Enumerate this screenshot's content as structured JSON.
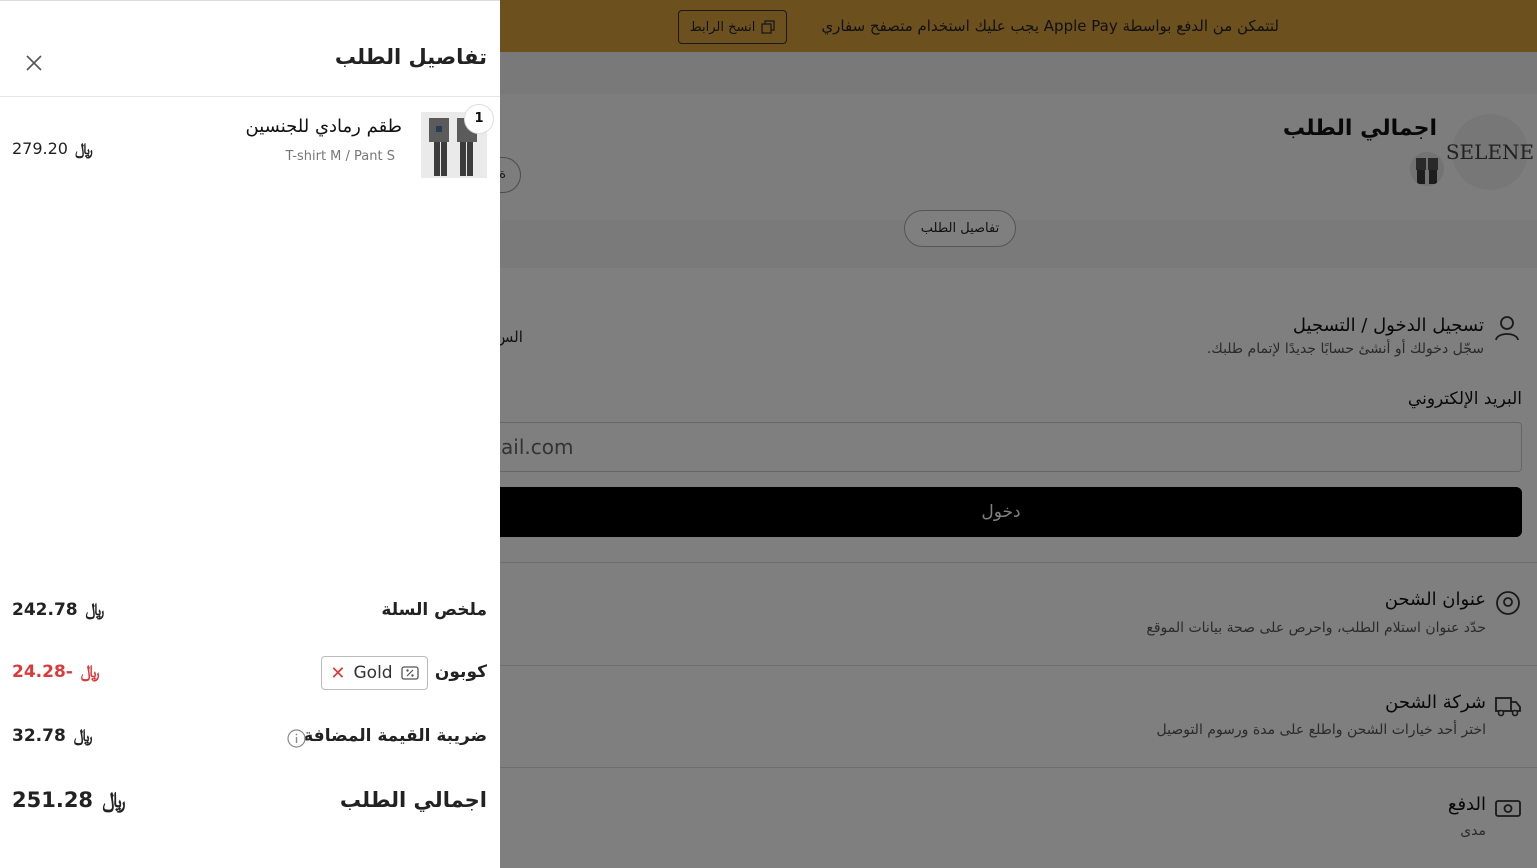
{
  "banner": {
    "text": "لتتمكن من الدفع بواسطة Apple Pay يجب عليك استخدام متصفح سفاري",
    "copy_label": "انسخ الرابط"
  },
  "summary": {
    "logo": "SELENE",
    "title": "اجمالي الطلب",
    "share_label": "ة",
    "details_label": "تفاصيل الطلب"
  },
  "login": {
    "title": "تسجيل الدخول / التسجيل",
    "subtitle": "سجّل دخولك أو أنشئ حسابًا جديدًا لإتمام طلبك.",
    "side_text": "الس",
    "email_label": "البريد الإلكتروني",
    "email_value": "ail.com",
    "submit_label": "دخول"
  },
  "sections": {
    "shipping_address": {
      "title": "عنوان الشحن",
      "subtitle": "حدّد عنوان استلام الطلب، واحرص على صحة بيانات الموقع"
    },
    "shipping_company": {
      "title": "شركة الشحن",
      "subtitle": "اختر أحد خيارات الشحن واطلع على مدة ورسوم التوصيل"
    },
    "payment": {
      "title": "الدفع",
      "subtitle": "مدى"
    }
  },
  "drawer": {
    "title": "تفاصيل الطلب",
    "item": {
      "name": "طقم رمادي للجنسين",
      "variant": "T-shirt M / Pant S",
      "quantity": "1",
      "price": "279.20"
    },
    "currency_symbol": "﷼",
    "cart_summary": {
      "label": "ملخص السلة",
      "value": "242.78"
    },
    "coupon": {
      "label": "كوبون",
      "code": "Gold",
      "value": "-24.28"
    },
    "vat": {
      "label": "ضريبة القيمة المضافة",
      "value": "32.78"
    },
    "total": {
      "label": "اجمالي الطلب",
      "value": "251.28"
    }
  },
  "colors": {
    "banner": "#d8a23e",
    "discount": "#d93a3a",
    "button": "#000000"
  },
  "icons": {
    "close": "close-icon",
    "copy": "copy-icon",
    "user": "user-icon",
    "location": "location-pin-icon",
    "truck": "truck-icon",
    "money": "money-icon",
    "coupon": "coupon-icon",
    "info": "info-icon"
  }
}
